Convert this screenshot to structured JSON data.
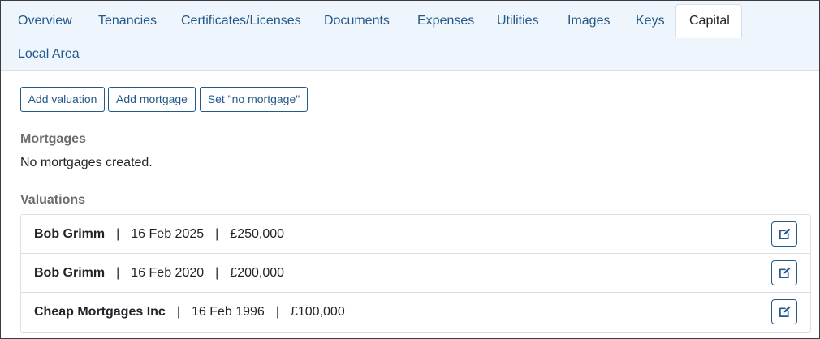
{
  "tabs": [
    {
      "label": "Overview"
    },
    {
      "label": "Tenancies"
    },
    {
      "label": "Certificates/Licenses"
    },
    {
      "label": "Documents"
    },
    {
      "label": "Expenses"
    },
    {
      "label": "Utilities"
    },
    {
      "label": "Images"
    },
    {
      "label": "Keys"
    },
    {
      "label": "Capital",
      "active": true
    },
    {
      "label": "Local Area"
    }
  ],
  "actions": {
    "add_valuation": "Add valuation",
    "add_mortgage": "Add mortgage",
    "set_no_mortgage": "Set \"no mortgage\""
  },
  "mortgages": {
    "heading": "Mortgages",
    "empty_text": "No mortgages created."
  },
  "valuations": {
    "heading": "Valuations",
    "separator": "|",
    "items": [
      {
        "valuer": "Bob Grimm",
        "date": "16 Feb 2025",
        "amount": "£250,000"
      },
      {
        "valuer": "Bob Grimm",
        "date": "16 Feb 2020",
        "amount": "£200,000"
      },
      {
        "valuer": "Cheap Mortgages Inc",
        "date": "16 Feb 1996",
        "amount": "£100,000"
      }
    ]
  },
  "colors": {
    "accent": "#24598a",
    "tabbar_bg": "#eef5fc",
    "heading_gray": "#6c6c6c"
  },
  "icons": {
    "edit": "edit-icon"
  }
}
